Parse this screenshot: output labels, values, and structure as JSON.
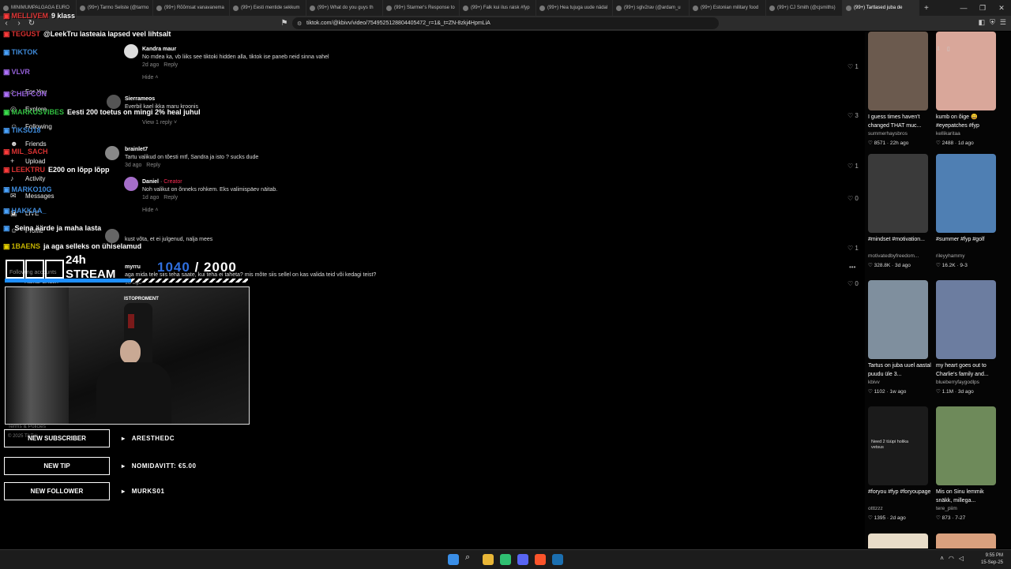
{
  "browser": {
    "tabs": [
      {
        "label": "MINIMUMPALGAGA EURO"
      },
      {
        "label": "(99+) Tarmo Seliste (@tarmo"
      },
      {
        "label": "(99+) Rõõmsat vanavanema"
      },
      {
        "label": "(99+) Eesti mentide sekkum"
      },
      {
        "label": "(99+) What do you guys th"
      },
      {
        "label": "(99+) Starmer's Response to"
      },
      {
        "label": "(99+) Falk kui ilus raisk #fyp"
      },
      {
        "label": "(99+) Hea tujuga uude nädal"
      },
      {
        "label": "(99+) sglv2rav (@ardam_u"
      },
      {
        "label": "(99+) Estonian military food"
      },
      {
        "label": "(99+) CJ Smith (@cjsmiths)"
      },
      {
        "label": "(99+) Tartlased juba de"
      }
    ],
    "new_tab": "+",
    "url": "tiktok.com/@kbivv/video/7549525128804405472_r=1&_t=ZN-8zkj4HpmLiA"
  },
  "stream_overlay": {
    "chat": [
      {
        "user": "MELLIVEM",
        "message": "9 klass",
        "user_color": "#ff3b3b"
      },
      {
        "user": "TEGUST",
        "message": "@LeekTru lasteaia lapsed veel lihtsalt",
        "user_color": "#ff3b3b"
      },
      {
        "user": "TIKTOK",
        "message": "",
        "user_color": "#4aa3ff"
      },
      {
        "user": "VLVR",
        "message": "",
        "user_color": "#b072ff"
      },
      {
        "user": "CHEFCON",
        "message": "",
        "user_color": "#b072ff"
      },
      {
        "user": "MARKUSVIBES",
        "message": "Eesti 200 toetus on mingi 2% heal juhul",
        "user_color": "#3adf4c"
      },
      {
        "user": "TIKSU18",
        "message": "",
        "user_color": "#4aa3ff"
      },
      {
        "user": "MIL_SACH",
        "message": "",
        "user_color": "#ff3b3b"
      },
      {
        "user": "LEEKTRU",
        "message": "E200 on lõpp lõpp",
        "user_color": "#ff3b3b"
      },
      {
        "user": "MARKO10G",
        "message": "",
        "user_color": "#4aa3ff"
      },
      {
        "user": "HAKKAA_",
        "message": "",
        "user_color": "#4aa3ff"
      },
      {
        "user": "",
        "message": "Seina äärde ja maha lasta",
        "user_color": "#4aa3ff"
      },
      {
        "user": "1BAENS",
        "message": "ja aga selleks on ühiselamud",
        "user_color": "#e6d000"
      }
    ],
    "timer_label_top": "24h",
    "timer_label_bottom": "STREAM",
    "goal_current": "1040",
    "goal_separator": "/",
    "goal_target": "2000",
    "cam_overlay_text": "ISTOPROMENT",
    "alerts": [
      {
        "label": "NEW SUBSCRIBER",
        "value": "ARESTHEDC"
      },
      {
        "label": "NEW TIP",
        "value": "NOMIDAVITT: €5.00"
      },
      {
        "label": "NEW FOLLOWER",
        "value": "MURKS01"
      }
    ]
  },
  "tiktok_nav": {
    "items": [
      {
        "label": "For You",
        "icon": "home-icon"
      },
      {
        "label": "Explore",
        "icon": "compass-icon"
      },
      {
        "label": "Following",
        "icon": "following-icon"
      },
      {
        "label": "Friends",
        "icon": "friends-icon"
      },
      {
        "label": "Upload",
        "icon": "plus-icon"
      },
      {
        "label": "Activity",
        "icon": "bell-icon"
      },
      {
        "label": "Messages",
        "icon": "message-icon"
      },
      {
        "label": "LIVE",
        "icon": "live-icon"
      },
      {
        "label": "Profile",
        "icon": "profile-icon"
      }
    ],
    "following_accounts": "Following accounts",
    "terms": "Terms & Policies",
    "copyright": "© 2025 TikTok"
  },
  "comments": [
    {
      "name": "Kandra maur",
      "text": "No mdea ka, vb liiks see tiktoki hidden alla, tiktok ise paneb neid sinna vahel",
      "time": "2d ago",
      "reply": "Reply",
      "likes": "1",
      "hide": "Hide"
    },
    {
      "name": "Sierrameos",
      "text": "Everbil kael ikka maru kroonis",
      "time": "",
      "reply": "Reply",
      "likes": "3",
      "view_replies": "View 1 reply"
    },
    {
      "name": "brainlet7",
      "text": "Tartu valikud on tõesti mtf, Sandra ja isto ? sucks dude",
      "time": "3d ago",
      "reply": "Reply",
      "likes": "1"
    },
    {
      "name": "Daniel",
      "creator": "Creator",
      "text": "Noh valikut on õnneks rohkem. Eks valimispäev näitab.",
      "time": "1d ago",
      "reply": "Reply",
      "likes": "0",
      "hide": "Hide"
    },
    {
      "name": "",
      "text": "kust võta, et ei julgenud, nalja mees",
      "time": "",
      "reply": "",
      "likes": "1"
    },
    {
      "name": "myrru",
      "text": "aga mida tele siis teha saate, kui teha ei taheta? mis mõte siis sellel on kas valida teid või kedagi teist?",
      "time": "1d ago",
      "reply": "",
      "likes": "0"
    },
    {
      "name": "Rainar Ehden",
      "text": "",
      "time": "",
      "reply": "",
      "likes": ""
    }
  ],
  "related_videos": [
    {
      "title": "I guess times haven't changed THAT muc...",
      "author": "summerhaysbros",
      "views": "8571",
      "date": "22h ago",
      "color": "#6b5a4e"
    },
    {
      "title": "kumb on õige 😀 #eyepatches #fyp",
      "author": "kellikaritaa",
      "views": "2488",
      "date": "1d ago",
      "color": "#d9a79a"
    },
    {
      "title": "#mindset #motivation...",
      "author": "motivatedbyfreedom...",
      "views": "328.8K",
      "date": "3d ago",
      "color": "#3a3a3a"
    },
    {
      "title": "#summer #fyp #golf",
      "author": "rileyyhammy",
      "views": "16.2K",
      "date": "9-3",
      "color": "#4f7fb3"
    },
    {
      "title": "Tartus on juba uuel aastal puudu üle 3...",
      "author": "kbivv",
      "views": "1102",
      "date": "1w ago",
      "color": "#7f8f9e"
    },
    {
      "title": "my heart goes out to Charlie's family and...",
      "author": "blueberryfaygodlps",
      "views": "1.1M",
      "date": "3d ago",
      "color": "#6c7da0"
    },
    {
      "title": "#foryou #fyp #foryoupage",
      "author": "otttzzz",
      "views": "1395",
      "date": "2d ago",
      "color": "#1b1b1b",
      "thumb_text": "Need 2 tüüpi holika vetsus"
    },
    {
      "title": "Mis on Sinu lemmik snäkk, millega...",
      "author": "tere_piim",
      "views": "873",
      "date": "7-27",
      "color": "#6e8a5a"
    }
  ],
  "taskbar": {
    "time": "9:55 PM",
    "date": "15-Sep-25"
  }
}
